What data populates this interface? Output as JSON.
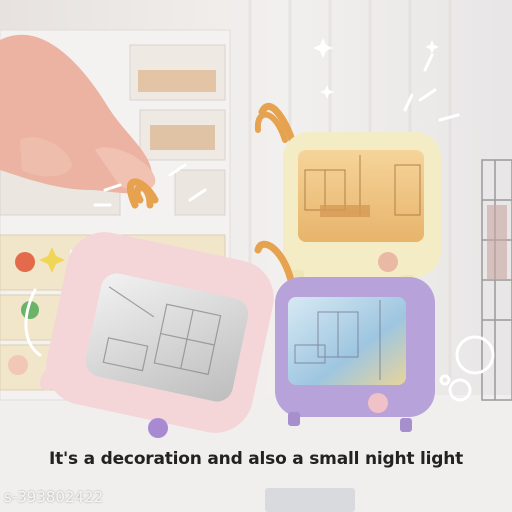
{
  "caption": "It's a decoration and also a small night light",
  "watermark": "s-393802422",
  "colors": {
    "pink_case": "#f4d6d8",
    "cream_case": "#f3ecc4",
    "purple_case": "#b8a2da",
    "strap": "#e6a24f",
    "button": "#a88ad3"
  }
}
